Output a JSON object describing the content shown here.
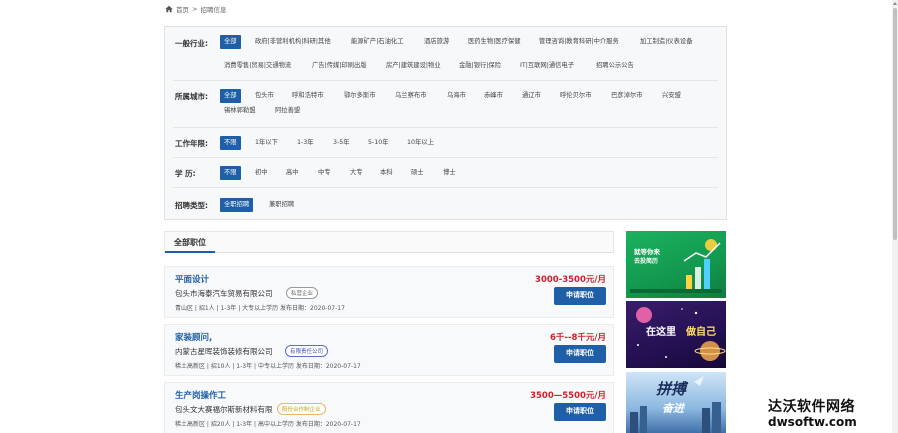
{
  "breadcrumb": {
    "home": "首页",
    "separator": ">",
    "current": "招聘信息"
  },
  "filters": [
    {
      "label": "一般行业:",
      "options": [
        "全部",
        "政府|非营利机构|科研|其他",
        "能源矿产|石油化工",
        "酒店旅游",
        "医药生物|医疗保健",
        "管理咨询|教育科研|中介服务",
        "加工制造|仪表设备",
        "消费零售|贸易|交通物流",
        "广告|传媒|印刷出版",
        "房产|建筑建设|物业",
        "金融|银行|保险",
        "IT|互联网|通信电子",
        "招聘公示公告"
      ]
    },
    {
      "label": "所属城市:",
      "options": [
        "全部",
        "包头市",
        "呼和浩特市",
        "鄂尔多斯市",
        "乌兰察布市",
        "乌海市",
        "赤峰市",
        "通辽市",
        "呼伦贝尔市",
        "巴彦淖尔市",
        "兴安盟",
        "锡林郭勒盟",
        "阿拉善盟"
      ]
    },
    {
      "label": "工作年限:",
      "options": [
        "不限",
        "1年以下",
        "1-3年",
        "3-5年",
        "5-10年",
        "10年以上"
      ]
    },
    {
      "label": "学    历:",
      "options": [
        "不限",
        "初中",
        "高中",
        "中专",
        "大专",
        "本科",
        "硕士",
        "博士"
      ]
    },
    {
      "label": "招聘类型:",
      "options": [
        "全职招聘",
        "兼职招聘"
      ]
    }
  ],
  "list": {
    "tab_label": "全部职位"
  },
  "jobs": [
    {
      "title": "平面设计",
      "salary": "3000-3500元/月",
      "company": "包头市海泰汽车贸易有限公司",
      "badge": "私营企业",
      "meta": "青山区  |  招1人  |  1-3年  |  大专以上学历    发布日期：2020-07-17",
      "apply": "申请职位"
    },
    {
      "title": "家装顾问,",
      "salary": "6千--8千元/月",
      "company": "内蒙古星晖装饰装修有限公司",
      "badge": "有限责任公司",
      "meta": "稀土高新区  |  招10人  |  1-3年  |  中专以上学历    发布日期：2020-07-17",
      "apply": "申请职位"
    },
    {
      "title": "生产岗操作工",
      "salary": "3500—5500元/月",
      "company": "包头文大赛福尔斯新材料有限",
      "badge": "股份合作制企业",
      "meta": "稀土高新区  |  招20人  |  1-3年  |  高中以上学历    发布日期：2020-07-17",
      "apply": "申请职位"
    }
  ],
  "ads": [
    {
      "line1": "就等你来",
      "line2": "去投简历"
    },
    {
      "line1": "在这里",
      "line2": "做自己"
    },
    {
      "line1": "拼搏",
      "line2": "奋进"
    }
  ],
  "watermark": {
    "main": "达沃软件网络",
    "sub": "dwsoftw.com"
  },
  "colors": {
    "accent": "#1f5fa8",
    "salary": "#d1202a",
    "panel_bg": "#f7f8fa"
  }
}
